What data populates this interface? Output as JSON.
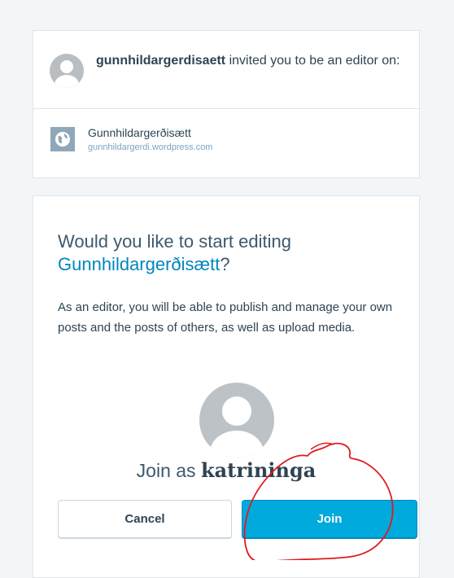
{
  "invite": {
    "inviter": "gunnhildargerdisaett",
    "message_rest": " invited you to be an editor on:"
  },
  "site": {
    "name": "Gunnhildargerðisætt",
    "url": "gunnhildargerdi.wordpress.com"
  },
  "join": {
    "question_prefix": "Would you like to start editing ",
    "question_site": "Gunnhildargerðisætt",
    "question_suffix": "?",
    "description": "As an editor, you will be able to publish and manage your own posts and the posts of others, as well as upload media.",
    "join_as_prefix": "Join as ",
    "username": "katriningа"
  },
  "buttons": {
    "cancel_label": "Cancel",
    "join_label": "Join"
  },
  "icons": {
    "inviter_avatar": "user-avatar-icon",
    "site_icon": "globe-icon",
    "user_avatar": "user-avatar-icon"
  },
  "colors": {
    "primary": "#00aadc",
    "link": "#0087be",
    "annotation": "#e0191e"
  }
}
